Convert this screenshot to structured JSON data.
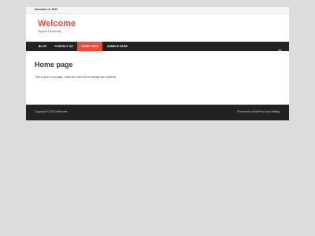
{
  "topbar": {
    "date": "November 8, 2020"
  },
  "header": {
    "site_title": "Welcome",
    "site_description": "Support Community"
  },
  "nav": {
    "items": [
      {
        "label": "BLOG"
      },
      {
        "label": "CONTACT US"
      },
      {
        "label": "HOME PAGE"
      },
      {
        "label": "SAMPLE PAGE"
      }
    ],
    "active_index": 2,
    "search_icon": "search-icon"
  },
  "main": {
    "title": "Home page",
    "content": "This is your front page. Click the 'edit' link to change the contents"
  },
  "footer": {
    "copyright": "Copyright © 2020 Welcome.",
    "credit": "Powered by WordPress and HitMag."
  },
  "colors": {
    "accent": "#e74c3c",
    "nav_bg": "#222222",
    "page_bg": "#dcdcdc"
  }
}
